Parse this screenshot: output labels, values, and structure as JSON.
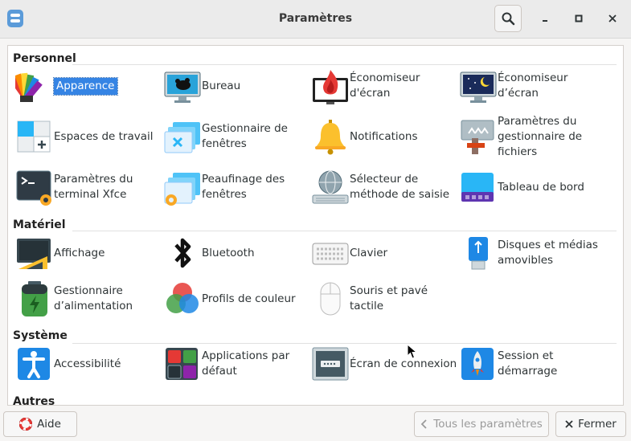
{
  "window": {
    "title": "Paramètres"
  },
  "sections": {
    "personnel": "Personnel",
    "materiel": "Matériel",
    "systeme": "Système",
    "autres": "Autres"
  },
  "items": {
    "apparence": "Apparence",
    "bureau": "Bureau",
    "economiseur1": "Économiseur d'écran",
    "economiseur2": "Économiseur d’écran",
    "espaces": "Espaces de travail",
    "gestfenetres": "Gestionnaire de fenêtres",
    "notifications": "Notifications",
    "gestfichiers": "Paramètres du gestionnaire de fichiers",
    "terminal": "Paramètres du terminal Xfce",
    "peaufinage": "Peaufinage des fenêtres",
    "selecteur": "Sélecteur de méthode de saisie",
    "tableau": "Tableau de bord",
    "affichage": "Affichage",
    "bluetooth": "Bluetooth",
    "clavier": "Clavier",
    "disques": "Disques et médias amovibles",
    "alimentation": "Gestionnaire d’alimentation",
    "profils": "Profils de couleur",
    "souris": "Souris et pavé tactile",
    "accessibilite": "Accessibilité",
    "applications": "Applications par défaut",
    "ecranconnexion": "Écran de connexion",
    "session": "Session et démarrage"
  },
  "footer": {
    "help": "Aide",
    "all_settings": "Tous les paramètres",
    "close": "Fermer"
  },
  "colors": {
    "accent": "#3584e4"
  }
}
